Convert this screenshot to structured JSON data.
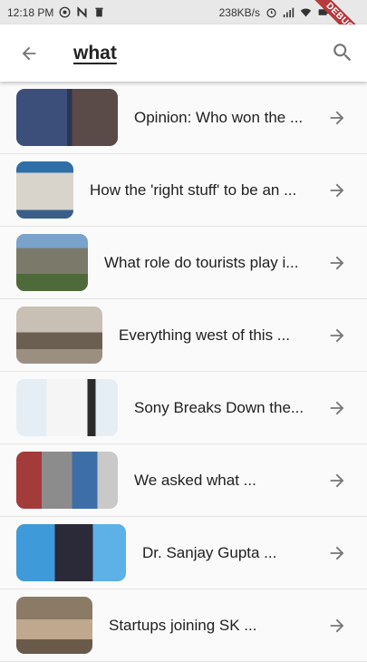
{
  "status_bar": {
    "time": "12:18 PM",
    "speed": "238KB/s",
    "left_icons": [
      "whatsapp-icon",
      "n-app-icon",
      "trash-icon"
    ],
    "right_icons": [
      "alarm-icon",
      "signal-icon",
      "wifi-icon",
      "battery-icon"
    ],
    "debug_banner": "DEBUG"
  },
  "app_bar": {
    "back_icon": "arrow-back-icon",
    "query": "what",
    "search_icon": "search-icon"
  },
  "results": [
    {
      "title": "Opinion: Who won the ...",
      "thumb_colors": [
        "#3b4f7a",
        "#c9a9a0"
      ]
    },
    {
      "title": "How the 'right stuff' to be an ...",
      "thumb_colors": [
        "#2f6fa8",
        "#c9c4b8"
      ]
    },
    {
      "title": "What role do tourists play i...",
      "thumb_colors": [
        "#5b87b3",
        "#7d8a6a"
      ]
    },
    {
      "title": "Everything west of this ...",
      "thumb_colors": [
        "#b7ab9b",
        "#6b5f52"
      ]
    },
    {
      "title": "Sony Breaks Down the...",
      "thumb_colors": [
        "#e6eef5",
        "#2b2b2b"
      ]
    },
    {
      "title": "We asked what ...",
      "thumb_colors": [
        "#a33b3b",
        "#3d6ea8"
      ]
    },
    {
      "title": "Dr. Sanjay Gupta ...",
      "thumb_colors": [
        "#3f9ad9",
        "#2a2a38"
      ]
    },
    {
      "title": "Startups joining SK ...",
      "thumb_colors": [
        "#8a7a66",
        "#bfa88d"
      ]
    }
  ],
  "colors": {
    "accent_debug": "#b5393d",
    "icon_gray": "#757575"
  }
}
